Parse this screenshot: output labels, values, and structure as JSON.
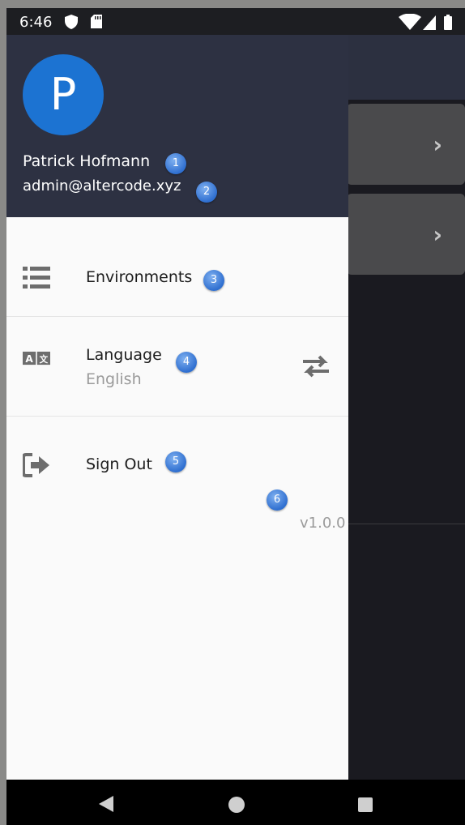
{
  "status_bar": {
    "time": "6:46",
    "icons": [
      "shield-icon",
      "sd-card-icon",
      "wifi-icon",
      "signal-icon",
      "battery-icon"
    ]
  },
  "drawer": {
    "avatar_letter": "P",
    "user_name": "Patrick Hofmann",
    "user_email": "admin@altercode.xyz",
    "items": [
      {
        "label": "Environments",
        "icon": "list-icon"
      },
      {
        "label": "Language",
        "sublabel": "English",
        "icon": "translate-icon",
        "action_icon": "swap-icon"
      },
      {
        "label": "Sign Out",
        "icon": "sign-out-icon"
      }
    ],
    "version": "v1.0.0"
  },
  "badges": [
    "1",
    "2",
    "3",
    "4",
    "5",
    "6"
  ],
  "colors": {
    "header": "#2d3142",
    "avatar": "#1c73d2",
    "drawer_bg": "#fafafa",
    "badge": "#3b7bd8"
  },
  "nav_bar": {
    "icons": [
      "back-icon",
      "home-icon",
      "recents-icon"
    ]
  }
}
